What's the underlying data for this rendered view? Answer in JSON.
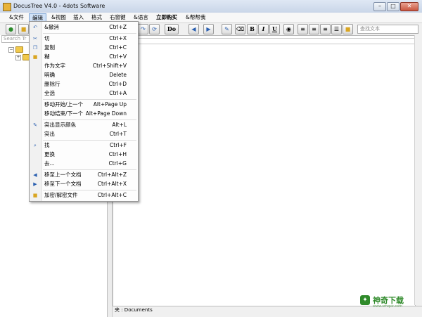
{
  "window": {
    "title": "DocusTree V4.0 - 4dots Software",
    "min": "–",
    "max": "□",
    "close": "✕"
  },
  "menubar": [
    "&文件",
    "编辑",
    "&视图",
    "插入",
    "格式",
    "右窗键",
    "&语言",
    "立即购买",
    "&帮帮我"
  ],
  "toolbar": {
    "do_label": "Do",
    "bold": "B",
    "italic": "I",
    "underline": "U",
    "search_placeholder": "查找文本"
  },
  "tree": {
    "search_placeholder": "Search Tr"
  },
  "statusbar": {
    "text": "夹 : Documents"
  },
  "edit_menu": {
    "items": [
      {
        "label": "&撤消",
        "shortcut": "Ctrl+Z",
        "icon": "undo-icon"
      },
      {
        "label": "切",
        "shortcut": "Ctrl+X",
        "icon": "cut-icon"
      },
      {
        "label": "复制",
        "shortcut": "Ctrl+C",
        "icon": "copy-icon"
      },
      {
        "label": "糊",
        "shortcut": "Ctrl+V",
        "icon": "paste-icon"
      },
      {
        "label": "作为文字",
        "shortcut": "Ctrl+Shift+V"
      },
      {
        "label": "明确",
        "shortcut": "Delete"
      },
      {
        "label": "删除行",
        "shortcut": "Ctrl+D"
      },
      {
        "label": "全选",
        "shortcut": "Ctrl+A"
      },
      {
        "label": "移动开始/上一个",
        "shortcut": "Alt+Page Up"
      },
      {
        "label": "移动结束/下一个",
        "shortcut": "Alt+Page Down"
      },
      {
        "label": "突出显示颜色",
        "shortcut": "Alt+L",
        "icon": "highlight-pen-icon"
      },
      {
        "label": "突出",
        "shortcut": "Ctrl+T"
      },
      {
        "label": "找",
        "shortcut": "Ctrl+F",
        "icon": "magnifier-icon"
      },
      {
        "label": "更换",
        "shortcut": "Ctrl+H"
      },
      {
        "label": "去...",
        "shortcut": "Ctrl+G"
      },
      {
        "label": "移至上一个文档",
        "shortcut": "Ctrl+Alt+Z",
        "icon": "arrow-left-icon"
      },
      {
        "label": "移至下一个文档",
        "shortcut": "Ctrl+Alt+X",
        "icon": "arrow-right-icon"
      },
      {
        "label": "加密/解密文件",
        "shortcut": "Ctrl+Alt+C",
        "icon": "lock-icon"
      }
    ]
  },
  "watermark": {
    "text": "神奇下载",
    "sub": "www.smqxz.com"
  },
  "colors": {
    "accent": "#2f8a2a",
    "menu_highlight": "#cfe1f7"
  }
}
